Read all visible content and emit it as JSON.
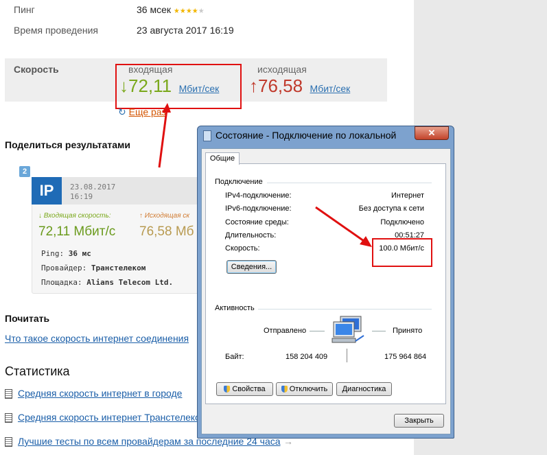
{
  "info": {
    "ping_label": "Пинг",
    "ping_value": "36 мсек",
    "ping_stars": 4,
    "time_label": "Время проведения",
    "time_value": "23 августа 2017 16:19"
  },
  "speed": {
    "title": "Скорость",
    "incoming_caption": "входящая",
    "incoming_arrow": "↓",
    "incoming_value": "72,11",
    "incoming_unit": "Мбит/сек",
    "outgoing_caption": "исходящая",
    "outgoing_arrow": "↑",
    "outgoing_value": "76,58",
    "outgoing_unit": "Мбит/сек",
    "retry_label": "Еще раз",
    "incoming_color": "#7aa81b",
    "outgoing_color": "#c0392b"
  },
  "share": {
    "title": "Поделиться результатами",
    "badge": "2",
    "card": {
      "logo": "IP",
      "date": "23.08.2017",
      "time": "16:19",
      "in_caption": "↓ Входящая скорость:",
      "in_value": "72,11 Мбит/с",
      "out_caption": "↑ Исходящая ск",
      "out_value": "76,58 Мб",
      "ping_label": "Ping:",
      "ping_value": "36 мс",
      "provider_label": "Провайдер:",
      "provider_value": "Транстелеком",
      "site_label": "Площадка:",
      "site_value": "Alians Telecom Ltd."
    }
  },
  "read": {
    "title": "Почитать",
    "link": "Что такое скорость интернет соединения"
  },
  "stats": {
    "title": "Статистика",
    "links": [
      "Средняя скорость интернет в городе",
      "Средняя скорость интернет Транстелеком",
      "Лучшие тесты по всем провайдерам за последние 24 часа"
    ],
    "last_arrow": "→"
  },
  "dialog": {
    "title": "Состояние - Подключение по локальной",
    "close": "✕",
    "tab": "Общие",
    "connection_group": "Подключение",
    "rows": [
      {
        "label": "IPv4-подключение:",
        "value": "Интернет"
      },
      {
        "label": "IPv6-подключение:",
        "value": "Без доступа к сети"
      },
      {
        "label": "Состояние среды:",
        "value": "Подключено"
      },
      {
        "label": "Длительность:",
        "value": "00:51:27"
      },
      {
        "label": "Скорость:",
        "value": "100.0 Мбит/с"
      }
    ],
    "details_button": "Сведения...",
    "activity_group": "Активность",
    "sent_label": "Отправлено",
    "received_label": "Принято",
    "bytes_label": "Байт:",
    "bytes_sent": "158 204 409",
    "bytes_received": "175 964 864",
    "btn_properties": "Свойства",
    "btn_disconnect": "Отключить",
    "btn_diagnostics": "Диагностика",
    "btn_close": "Закрыть"
  },
  "colors": {
    "annotation_red": "#e01010",
    "link_blue": "#1a5ea8",
    "logo_blue": "#1f6bb6"
  }
}
